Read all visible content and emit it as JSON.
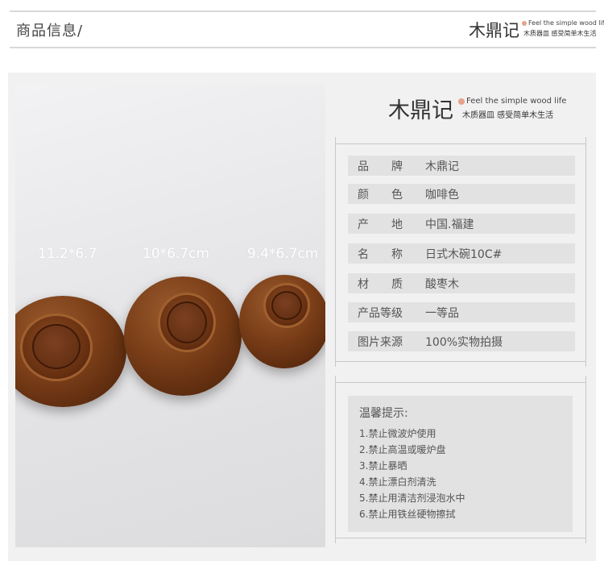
{
  "header": {
    "title": "商品信息/"
  },
  "brand": {
    "logo_cn": "木鼎记",
    "slogan_en": "Feel the simple wood life",
    "slogan_cn": "木质器皿 感受简单木生活"
  },
  "photo": {
    "sizes": [
      "11.2*6.7",
      "10*6.7cm",
      "9.4*6.7cm"
    ]
  },
  "specs": [
    {
      "key": "品　　牌",
      "value": "木鼎记"
    },
    {
      "key": "颜　　色",
      "value": "咖啡色"
    },
    {
      "key": "产　　地",
      "value": "中国.福建"
    },
    {
      "key": "名　　称",
      "value": "日式木碗10C#"
    },
    {
      "key": "材　　质",
      "value": "酸枣木"
    },
    {
      "key": "产品等级",
      "value": "一等品"
    },
    {
      "key": "图片来源",
      "value": "100%实物拍摄"
    }
  ],
  "tips": {
    "title": "温馨提示:",
    "items": [
      "1.禁止微波炉使用",
      "2.禁止高温或暖炉盘",
      "3.禁止暴晒",
      "4.禁止漂白剂清洗",
      "5.禁止用清洁剂浸泡水中",
      "6.禁止用铁丝硬物擦拭"
    ]
  },
  "colors": {
    "accent_dot": "#e6a38a",
    "panel_gray": "#e2e2e2",
    "wood": "#7a3e18"
  }
}
